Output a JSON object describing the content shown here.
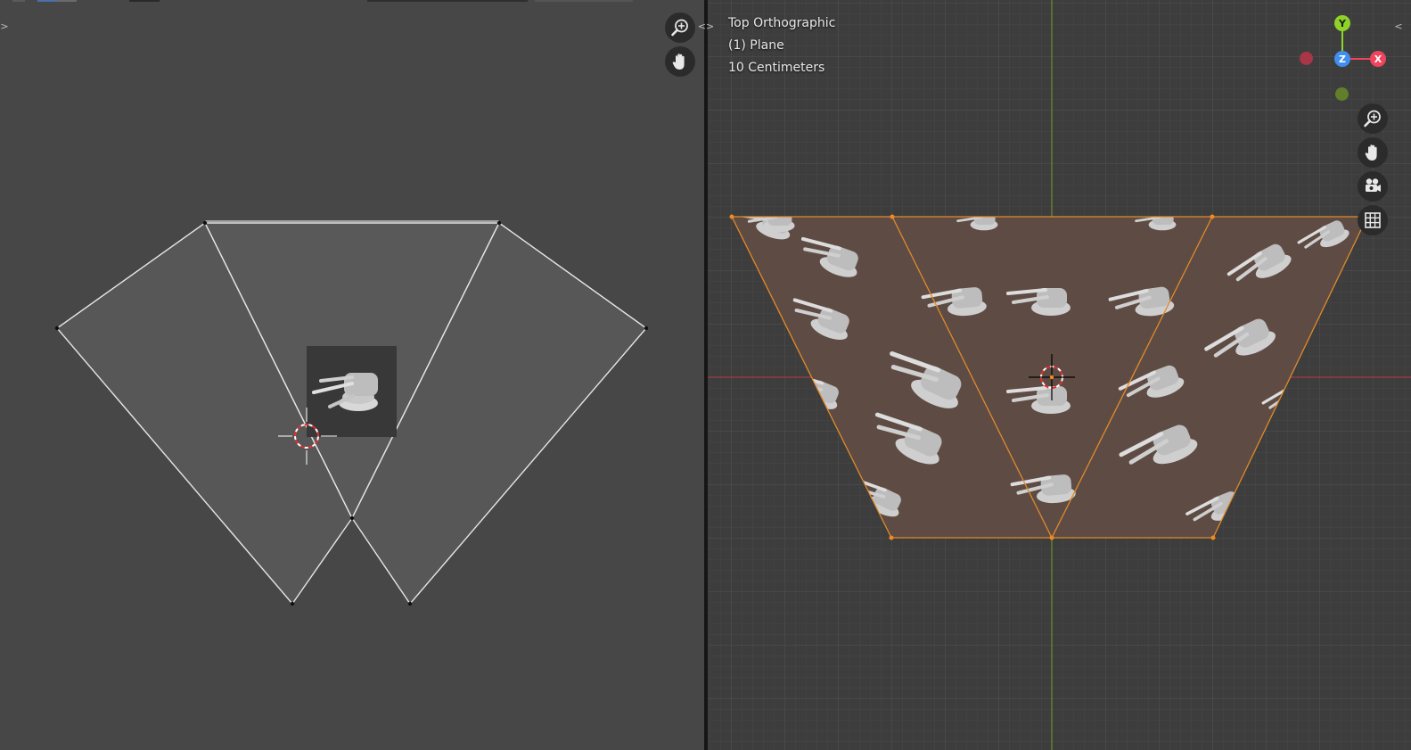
{
  "uv_editor": {
    "toggle_label": ">"
  },
  "viewport": {
    "view_name": "Top Orthographic",
    "object_name": "(1) Plane",
    "grid_scale": "10 Centimeters",
    "toggle_label": "<",
    "split_toggle_label": "<>"
  },
  "gizmo": {
    "y_label": "Y",
    "z_label": "Z",
    "x_label": "X",
    "colors": {
      "x": "#f0435d",
      "y": "#8ed328",
      "z": "#3f8ef0",
      "neg_x": "#a83646",
      "neg_y": "#617f2a"
    }
  },
  "icons": {
    "zoom": "zoom-icon",
    "pan": "hand-icon",
    "camera": "camera-icon",
    "perspective": "grid-icon"
  },
  "colors": {
    "uv_bg": "#474747",
    "uv_face": "#5a5a5a",
    "mesh_face": "#5e4c44",
    "selection": "#e08a2a",
    "axis_x": "#a53d44",
    "axis_y": "#6f8f2b"
  }
}
